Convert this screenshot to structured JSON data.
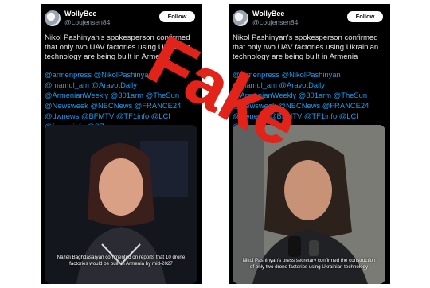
{
  "left_post": {
    "name": "WollyBee",
    "handle": "@Loujensen84",
    "follow_label": "Follow",
    "text": "Nikol Pashinyan's spokesperson confirmed that only two UAV factories using Ukrainian technology are being built in Armenia",
    "hashtags": "@armenpress @NikolPashinyan @mamul_am @AravotDaily @ArmenianWeekly @301arm @TheSun @Newsweek @NBCNews @FRANCE24 @dwnews @BFMTV @TF1info @LCI @franceinfo @SZ",
    "caption": "Nazeli Baghdasaryan commented on reports that 10 drone factories would be built in Armenia by mid-2027"
  },
  "right_post": {
    "name": "WollyBee",
    "handle": "@Loujensen84",
    "follow_label": "Follow",
    "text": "Nikol Pashinyan's spokesperson confirmed that only two UAV factories using Ukrainian technology are being built in Armenia",
    "hashtags": "@armenpress @NikolPashinyan @mamul_am @AravotDaily @ArmenianWeekly @301arm @TheSun @Newsweek @NBCNews @FRANCE24 @dwnews @BFMTV @TF1info @LCI @franceinfo @SZ",
    "caption": "Nikol Pashinyan's press secretary confirmed the construction of only two drone factories using Ukrainian technology"
  },
  "stamp": {
    "text": "Fake",
    "color": "#e2231a"
  },
  "icons": {
    "avatar": "avatar-icon"
  }
}
